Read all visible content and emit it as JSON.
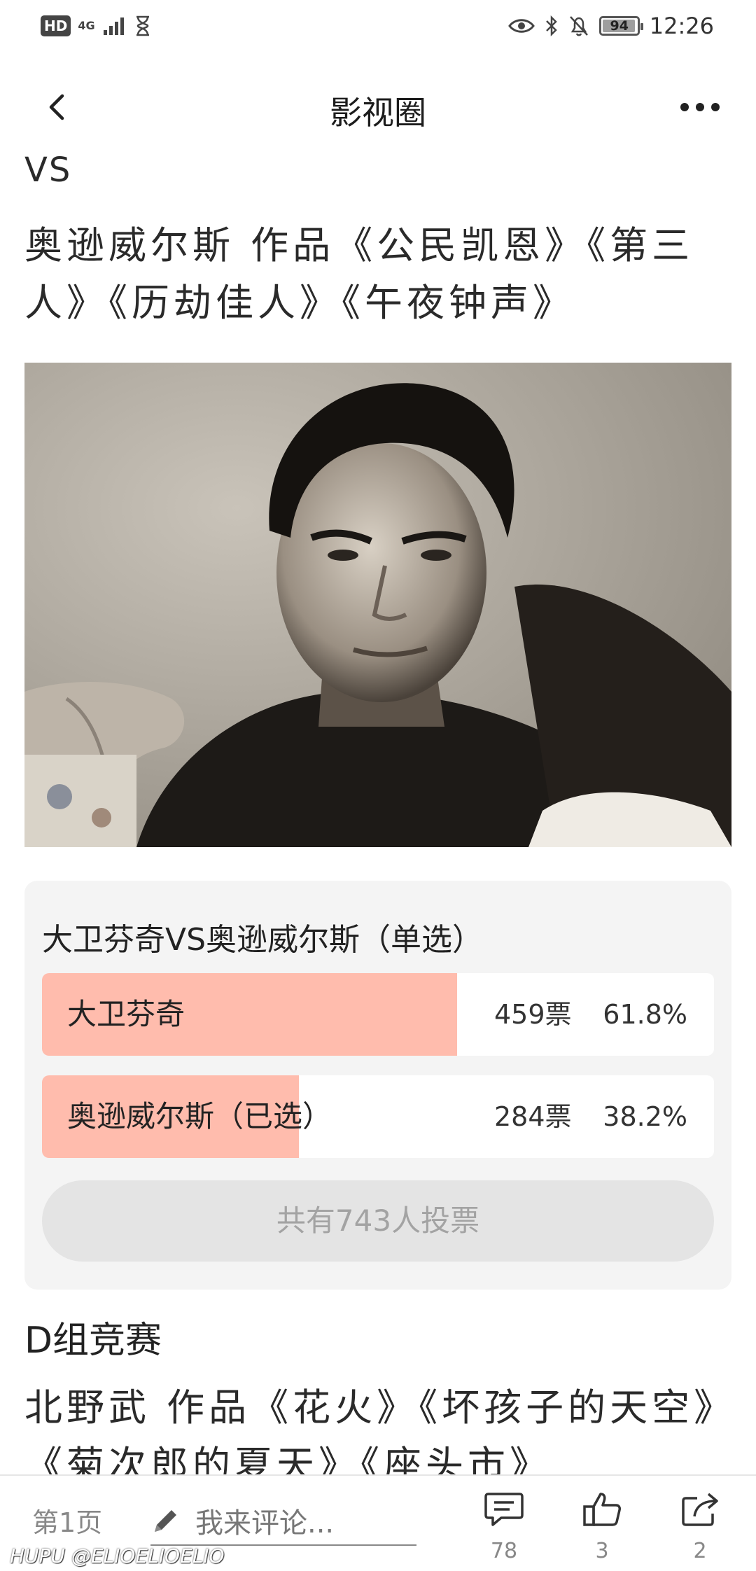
{
  "status_bar": {
    "hd": "HD",
    "network": "4G",
    "battery": "94",
    "time": "12:26"
  },
  "nav": {
    "title": "影视圈"
  },
  "post": {
    "vs_text": "VS",
    "description": "奥逊威尔斯 作品《公民凯恩》《第三人》《历劫佳人》《午夜钟声》",
    "photo_alt": "black-and-white portrait"
  },
  "poll": {
    "title": "大卫芬奇VS奥逊威尔斯（单选）",
    "options": [
      {
        "label": "大卫芬奇",
        "votes": "459票",
        "percent": "61.8%",
        "share": 0.618
      },
      {
        "label": "奥逊威尔斯（已选）",
        "votes": "284票",
        "percent": "38.2%",
        "share": 0.382
      }
    ],
    "total": "共有743人投票"
  },
  "group": {
    "title": "D组竞赛",
    "description": "北野武 作品《花火》《坏孩子的天空》《菊次郎的夏天》《座头市》"
  },
  "bottom_bar": {
    "page": "第1页",
    "comment_placeholder": "我来评论...",
    "comments_count": "78",
    "likes_count": "3",
    "shares_count": "2"
  },
  "watermark": "HUPU @ELIOELIOELIO",
  "colors": {
    "poll_fill": "#ffbcad",
    "poll_bg": "#f4f4f4"
  }
}
